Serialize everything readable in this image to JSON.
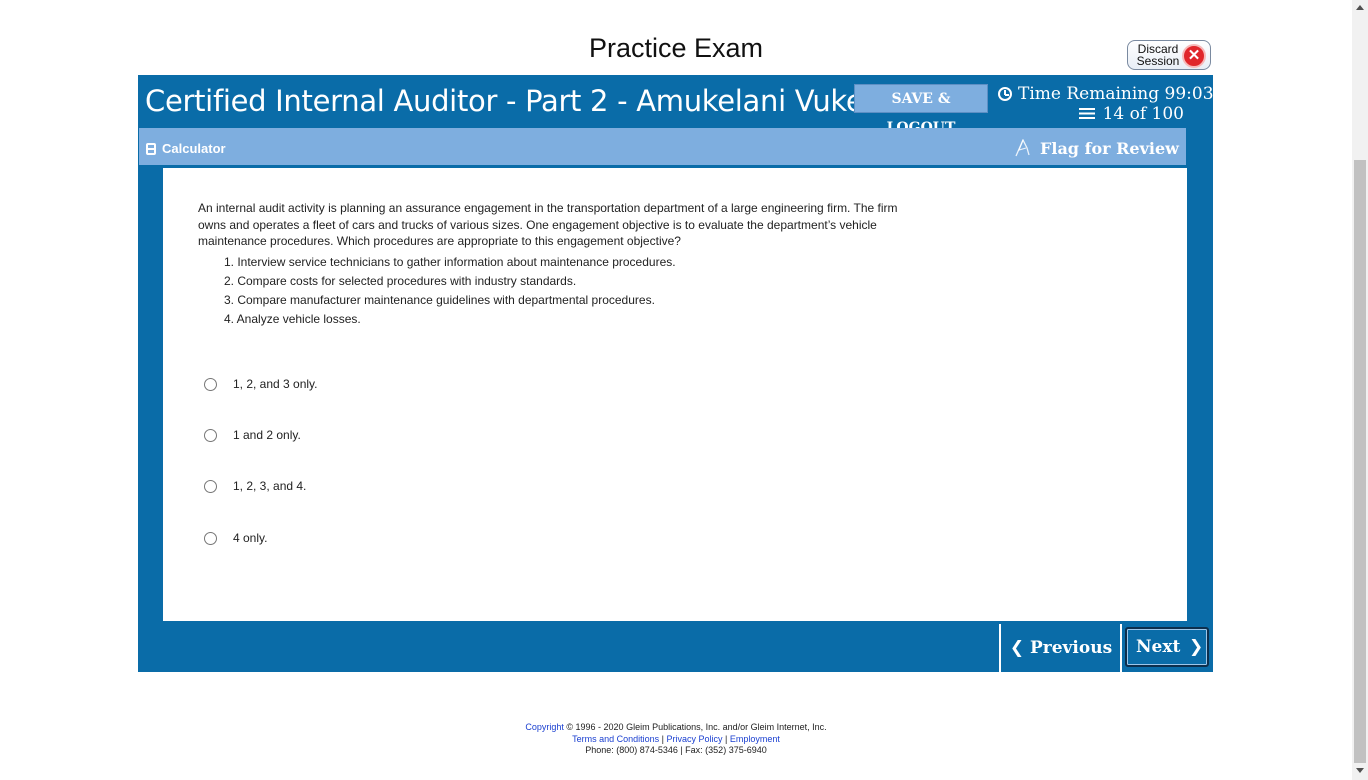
{
  "page": {
    "title": "Practice Exam"
  },
  "discard": {
    "label_line1": "Discard",
    "label_line2": "Session",
    "icon": "close-icon"
  },
  "header": {
    "course_title": "Certified Internal Auditor - Part 2 - Amukelani Vukela",
    "save_logout_label": "SAVE & LOGOUT",
    "time_remaining_label": "Time Remaining",
    "time_remaining_value": "99:03",
    "progress_text": "14 of 100"
  },
  "toolbar": {
    "calculator_label": "Calculator",
    "flag_label": "Flag for Review"
  },
  "question": {
    "stem": "An internal audit activity is planning an assurance engagement in the transportation department of a large engineering firm. The firm owns and operates a fleet of cars and trucks of various sizes. One engagement objective is to evaluate the department’s vehicle maintenance procedures. Which procedures are appropriate to this engagement objective?",
    "items": [
      "1. Interview service technicians to gather information about maintenance procedures.",
      "2. Compare costs for selected procedures with industry standards.",
      "3. Compare manufacturer maintenance guidelines with departmental procedures.",
      "4. Analyze vehicle losses."
    ],
    "options": [
      "1, 2, and 3 only.",
      "1 and 2 only.",
      "1, 2, 3, and 4.",
      "4 only."
    ]
  },
  "nav": {
    "previous_label": "Previous",
    "next_label": "Next"
  },
  "footer": {
    "copyright_link": "Copyright",
    "copyright_text": "© 1996 - 2020 Gleim Publications, Inc. and/or Gleim Internet, Inc.",
    "terms_link": "Terms and Conditions",
    "privacy_link": "Privacy Policy",
    "employment_link": "Employment",
    "separator": "|",
    "contact": "Phone: (800) 874-5346 | Fax: (352) 375-6940"
  },
  "colors": {
    "brand_blue": "#0a6ca8",
    "toolbar_blue": "#7eaedf",
    "discard_red": "#e0262b"
  }
}
